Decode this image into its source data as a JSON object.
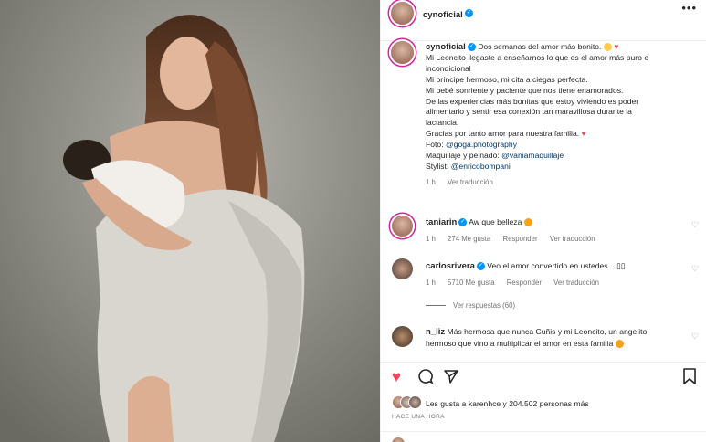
{
  "header": {
    "username": "cynoficial",
    "more_icon": "more-horizontal-icon"
  },
  "caption": {
    "username": "cynoficial",
    "lines": [
      "Dos semanas del amor más bonito.",
      "Mi Leoncito llegaste a enseñarnos lo que es el amor más puro e",
      "incondicional",
      "Mi príncipe hermoso, mi cita a ciegas perfecta.",
      "Mi bebé sonriente y paciente que nos tiene enamorados.",
      "De las experiencias más bonitas que estoy viviendo es poder",
      "alimentario y sentir esa conexión tan maravillosa durante la",
      "lactancia.",
      "Gracias por tanto amor para nuestra familia."
    ],
    "foto_label": "Foto:",
    "foto_link": "@goga.photography",
    "maquillaje_label": "Maquillaje y peinado:",
    "maquillaje_link": "@vaniamaquillaje",
    "stylist_label": "Stylist:",
    "stylist_link": "@enricobompani",
    "time": "1 h",
    "translate": "Ver traducción"
  },
  "comments": [
    {
      "username": "taniarin",
      "text": "Aw que belleza",
      "time": "1 h",
      "likes": "274 Me gusta",
      "reply": "Responder",
      "translate": "Ver traducción"
    },
    {
      "username": "carlosrivera",
      "text": "Veo el amor convertido en ustedes... ▯▯",
      "time": "1 h",
      "likes": "5710 Me gusta",
      "reply": "Responder",
      "translate": "Ver traducción",
      "view_replies": "Ver respuestas (60)"
    },
    {
      "username": "n_liz",
      "text_line1": "Más hermosa que nunca Cuñis y mi Leoncito, un angelito",
      "text_line2": "hermoso que vino a multiplicar el amor en esta familia"
    }
  ],
  "footer": {
    "likes_text": "Les gusta a karenhce y 204.502 personas más",
    "ago": "HACE UNA HORA"
  },
  "colors": {
    "like_red": "#ed4956",
    "link_blue": "#00376b",
    "verified_blue": "#0095f6"
  }
}
